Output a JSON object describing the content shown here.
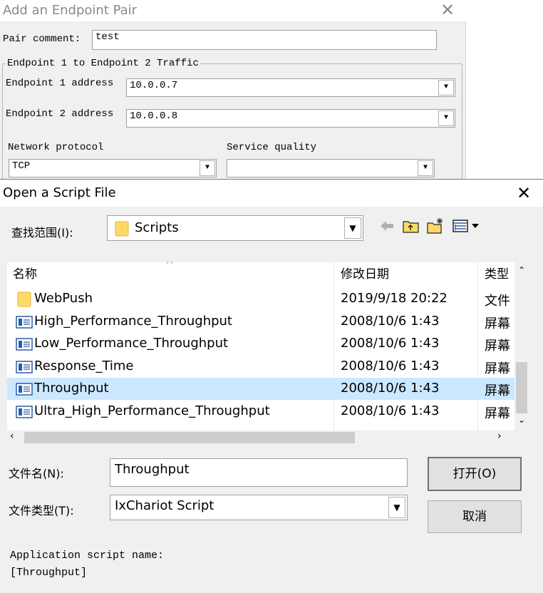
{
  "bg_dialog": {
    "title": "Add an Endpoint Pair",
    "pair_comment_label": "Pair comment:",
    "pair_comment_value": "test",
    "traffic_group_label": "Endpoint 1 to Endpoint 2 Traffic",
    "endpoint1_label": "Endpoint 1 address",
    "endpoint1_value": "10.0.0.7",
    "endpoint2_label": "Endpoint 2 address",
    "endpoint2_value": "10.0.0.8",
    "network_protocol_label": "Network protocol",
    "network_protocol_value": "TCP",
    "service_quality_label": "Service quality",
    "service_quality_value": ""
  },
  "fg_dialog": {
    "title": "Open a Script File",
    "lookin_label": "查找范围(I):",
    "lookin_value": "Scripts",
    "columns": {
      "name": "名称",
      "date": "修改日期",
      "type": "类型"
    },
    "files": [
      {
        "name": "WebPush",
        "date": "2019/9/18 20:22",
        "type": "文件",
        "kind": "folder"
      },
      {
        "name": "High_Performance_Throughput",
        "date": "2008/10/6 1:43",
        "type": "屏幕",
        "kind": "script"
      },
      {
        "name": "Low_Performance_Throughput",
        "date": "2008/10/6 1:43",
        "type": "屏幕",
        "kind": "script"
      },
      {
        "name": "Response_Time",
        "date": "2008/10/6 1:43",
        "type": "屏幕",
        "kind": "script"
      },
      {
        "name": "Throughput",
        "date": "2008/10/6 1:43",
        "type": "屏幕",
        "kind": "script",
        "selected": true
      },
      {
        "name": "Ultra_High_Performance_Throughput",
        "date": "2008/10/6 1:43",
        "type": "屏幕",
        "kind": "script"
      }
    ],
    "filename_label": "文件名(N):",
    "filename_value": "Throughput",
    "filetype_label": "文件类型(T):",
    "filetype_value": "IxChariot Script",
    "open_button": "打开(O)",
    "cancel_button": "取消",
    "app_script_label": "Application script name:",
    "app_script_value": "[Throughput]",
    "icons": {
      "back": "back-arrow-icon",
      "up": "up-folder-icon",
      "new_folder": "new-folder-icon",
      "view": "view-menu-icon",
      "close": "close-icon"
    },
    "selection_color": "#cce8ff"
  }
}
